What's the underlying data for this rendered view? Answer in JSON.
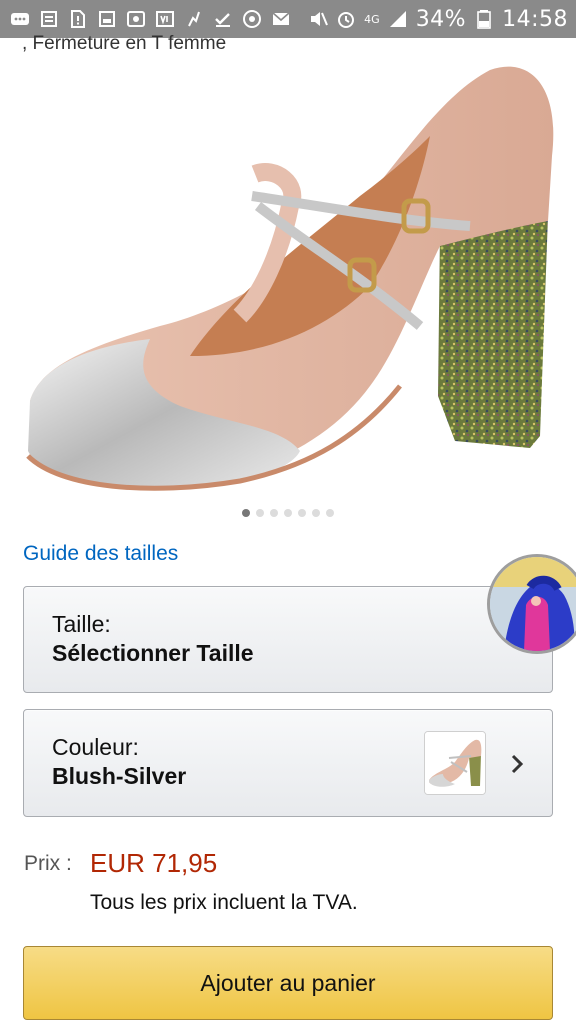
{
  "status_bar": {
    "left_icons": [
      "message-icon",
      "voicemail-icon",
      "file-alert-icon",
      "gallery-icon",
      "screen-record-icon",
      "vpn-icon",
      "fitness-icon",
      "check-icon",
      "speedometer-icon",
      "mail-icon"
    ],
    "right_icons": [
      "mute-icon",
      "alarm-icon",
      "network-4g-icon",
      "signal-icon"
    ],
    "network_label": "4G",
    "battery": "34%",
    "time": "14:58"
  },
  "product": {
    "title_fragment": ", Fermeture en T femme",
    "image_name": "blush-silver-t-bar-glitter-heel-shoe",
    "carousel": {
      "count": 7,
      "active_index": 0
    }
  },
  "size_guide": {
    "link_label": "Guide des tailles"
  },
  "size_selector": {
    "label": "Taille:",
    "value": "Sélectionner Taille"
  },
  "color_selector": {
    "label": "Couleur:",
    "value": "Blush-Silver",
    "swatch": "blush-silver-shoe-thumbnail",
    "chevron": "chevron-right-icon"
  },
  "floating_avatar": "chat-head-avatar",
  "price": {
    "label": "Prix :",
    "value": "EUR 71,95",
    "vat_note": "Tous les prix incluent la TVA."
  },
  "cart": {
    "button_label": "Ajouter au panier"
  },
  "colors": {
    "link": "#0066c0",
    "price": "#b12704",
    "cart_button": "#f0c14b",
    "status_bar": "#8a8a8a"
  }
}
